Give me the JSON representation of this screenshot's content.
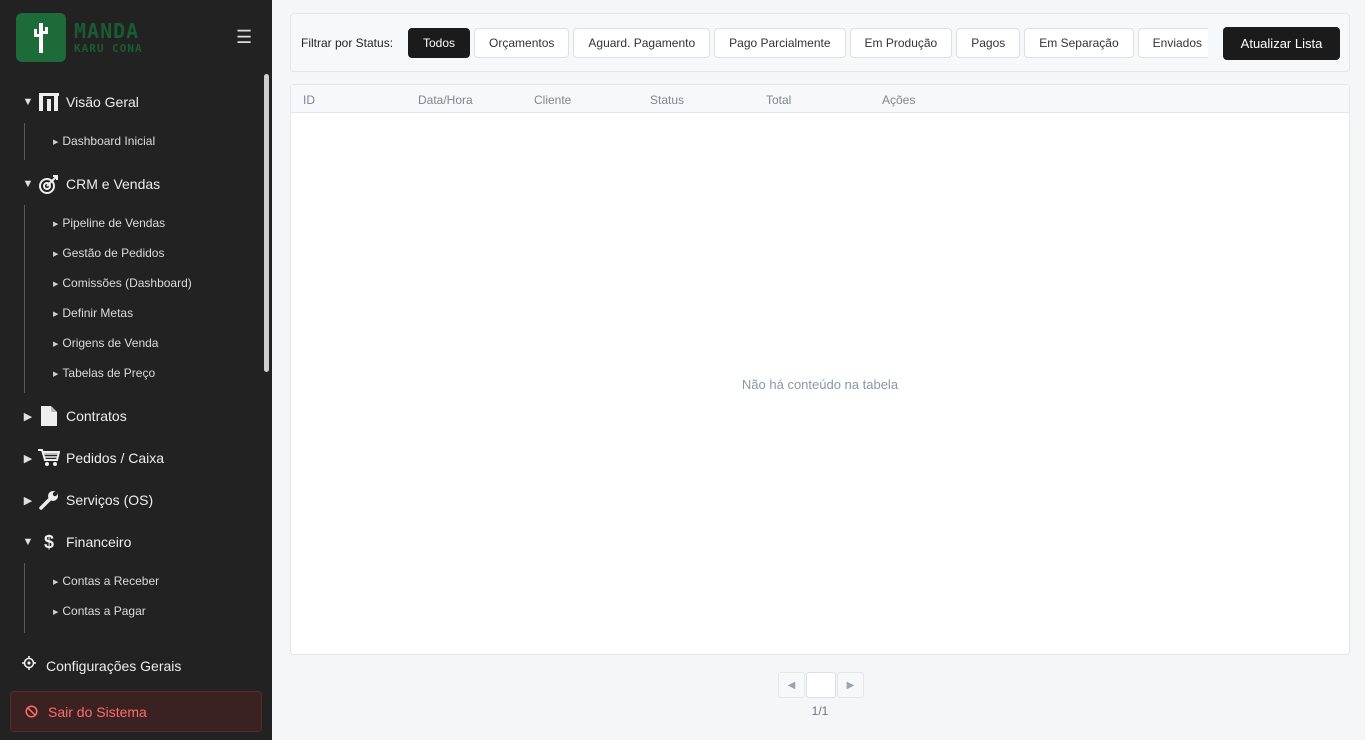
{
  "brand": {
    "line1": "MANDA",
    "line2": "KARU CONA"
  },
  "sidebar": {
    "sections": [
      {
        "label": "Visão Geral",
        "icon": "chart-bars-icon",
        "expanded": true,
        "items": [
          "Dashboard Inicial"
        ]
      },
      {
        "label": "CRM e Vendas",
        "icon": "target-icon",
        "expanded": true,
        "items": [
          "Pipeline de Vendas",
          "Gestão de Pedidos",
          "Comissões (Dashboard)",
          "Definir Metas",
          "Origens de Venda",
          "Tabelas de Preço"
        ]
      },
      {
        "label": "Contratos",
        "icon": "document-icon",
        "expanded": false,
        "items": []
      },
      {
        "label": "Pedidos / Caixa",
        "icon": "cart-icon",
        "expanded": false,
        "items": []
      },
      {
        "label": "Serviços (OS)",
        "icon": "wrench-icon",
        "expanded": false,
        "items": []
      },
      {
        "label": "Financeiro",
        "icon": "dollar-icon",
        "expanded": true,
        "items": [
          "Contas a Receber",
          "Contas a Pagar"
        ]
      }
    ],
    "config_label": "Configurações Gerais",
    "logout_label": "Sair do Sistema"
  },
  "filter": {
    "label": "Filtrar por Status:",
    "chips": [
      "Todos",
      "Orçamentos",
      "Aguard. Pagamento",
      "Pago Parcialmente",
      "Em Produção",
      "Pagos",
      "Em Separação",
      "Enviados"
    ],
    "active": "Todos",
    "refresh_label": "Atualizar Lista"
  },
  "table": {
    "columns": [
      "ID",
      "Data/Hora",
      "Cliente",
      "Status",
      "Total",
      "Ações"
    ],
    "empty_text": "Não há conteúdo na tabela"
  },
  "pagination": {
    "page_text": "1/1",
    "current": ""
  },
  "colors": {
    "sidebar_bg": "#222222",
    "brand_green": "#1e6b3a",
    "logout_text": "#ff6b6b",
    "accent_dark": "#1b1b1b"
  }
}
